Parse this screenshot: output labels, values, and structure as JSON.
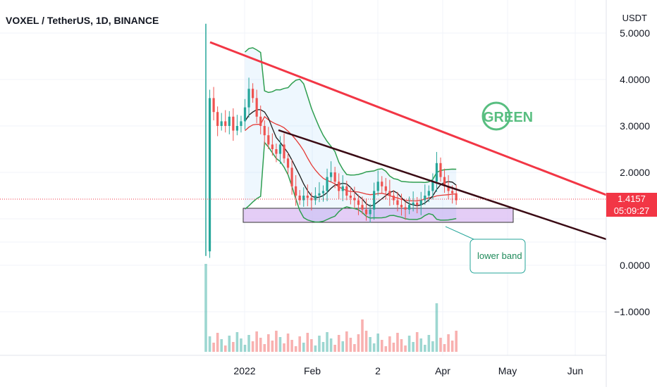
{
  "header": {
    "symbol": "VOXEL / TetherUS, 1D, BINANCE",
    "currency": "USDT"
  },
  "price_label": {
    "price": "1.4157",
    "countdown": "05:09:27"
  },
  "watermark": {
    "text": "GREEN"
  },
  "annotation": {
    "text": "lower band"
  },
  "colors": {
    "up": "#26a69a",
    "down": "#ef5350",
    "trendline_top": "#f23645",
    "trendline_mid": "#3a0a14",
    "band": "#2e9e50",
    "ma_red": "#e53935",
    "ma_dark": "#1b1b1b",
    "support_box": "#d9b8f2",
    "price_pill": "#f23645"
  },
  "chart_data": {
    "type": "candlestick",
    "xaxis": {
      "ticks": [
        "2022",
        "Feb",
        "2",
        "Apr",
        "May",
        "Jun"
      ]
    },
    "yaxis": {
      "ticks": [
        "5.0000",
        "4.0000",
        "3.0000",
        "2.0000",
        "0.0000",
        "−1.0000"
      ],
      "range": [
        -1.6,
        5.2
      ]
    },
    "current_price": 1.4157,
    "trendlines": [
      {
        "name": "",
        "from": [
          0.0,
          4.75
        ],
        "to": [
          1.0,
          1.55
        ]
      },
      {
        "name": "",
        "from": [
          0.18,
          2.9
        ],
        "to": [
          1.0,
          0.6
        ]
      }
    ],
    "support_zone": {
      "low": 1.0,
      "high": 1.3
    },
    "series_close": [
      0.3,
      3.6,
      3.3,
      3.0,
      3.1,
      3.0,
      3.2,
      2.9,
      3.0,
      3.1,
      3.4,
      3.8,
      3.6,
      3.2,
      3.0,
      2.8,
      2.6,
      2.5,
      2.4,
      2.6,
      2.3,
      2.1,
      1.7,
      1.5,
      1.4,
      1.5,
      1.45,
      1.4,
      1.5,
      1.55,
      1.6,
      1.9,
      2.0,
      1.8,
      1.6,
      1.7,
      1.5,
      1.45,
      1.4,
      1.3,
      1.2,
      1.1,
      1.2,
      1.6,
      1.8,
      1.7,
      1.6,
      1.5,
      1.4,
      1.3,
      1.25,
      1.2,
      1.3,
      1.35,
      1.3,
      1.4,
      1.5,
      1.6,
      1.8,
      2.2,
      1.9,
      1.7,
      1.6,
      1.55,
      1.4
    ]
  }
}
